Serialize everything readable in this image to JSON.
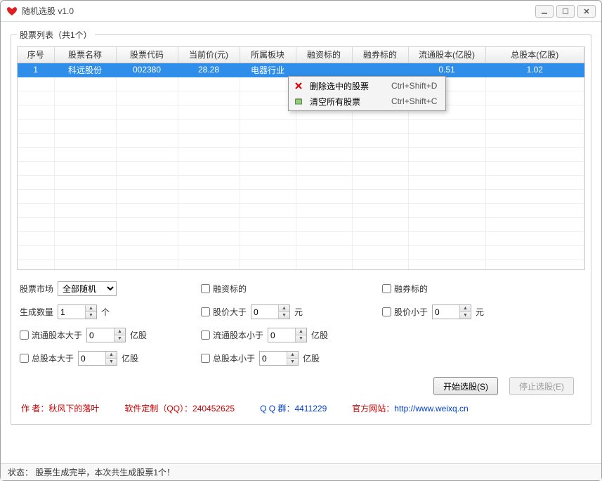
{
  "window": {
    "title": "随机选股 v1.0"
  },
  "group": {
    "legend": "股票列表（共1个）"
  },
  "table": {
    "headers": [
      "序号",
      "股票名称",
      "股票代码",
      "当前价(元)",
      "所属板块",
      "融资标的",
      "融券标的",
      "流通股本(亿股)",
      "总股本(亿股)"
    ],
    "rows": [
      {
        "cells": [
          "1",
          "科远股份",
          "002380",
          "28.28",
          "电器行业",
          "",
          "",
          "0.51",
          "1.02"
        ],
        "selected": true
      }
    ]
  },
  "context_menu": {
    "items": [
      {
        "icon": "x",
        "label": "删除选中的股票",
        "accel": "Ctrl+Shift+D"
      },
      {
        "icon": "box",
        "label": "清空所有股票",
        "accel": "Ctrl+Shift+C"
      }
    ]
  },
  "controls": {
    "market_label": "股票市场",
    "market_selected": "全部随机",
    "margin_finance": "融资标的",
    "margin_short": "融券标的",
    "gen_count_label": "生成数量",
    "gen_count_value": "1",
    "gen_count_unit": "个",
    "price_gt_label": "股价大于",
    "price_gt_value": "0",
    "price_lt_label": "股价小于",
    "price_lt_value": "0",
    "yuan": "元",
    "float_gt_label": "流通股本大于",
    "float_gt_value": "0",
    "float_lt_label": "流通股本小于",
    "float_lt_value": "0",
    "total_gt_label": "总股本大于",
    "total_gt_value": "0",
    "total_lt_label": "总股本小于",
    "total_lt_value": "0",
    "yigu": "亿股",
    "start_btn": "开始选股(S)",
    "stop_btn": "停止选股(E)"
  },
  "footer": {
    "author_label": "作 者：",
    "author": "秋风下的落叶",
    "custom_label": "软件定制（QQ）：",
    "custom_value": "240452625",
    "qqgroup_label": "Q Q 群：",
    "qqgroup_value": "4411229",
    "site_label": "官方网站：",
    "site_url": "http://www.weixq.cn"
  },
  "statusbar": {
    "label": "状态：",
    "text": "股票生成完毕，本次共生成股票1个！"
  }
}
